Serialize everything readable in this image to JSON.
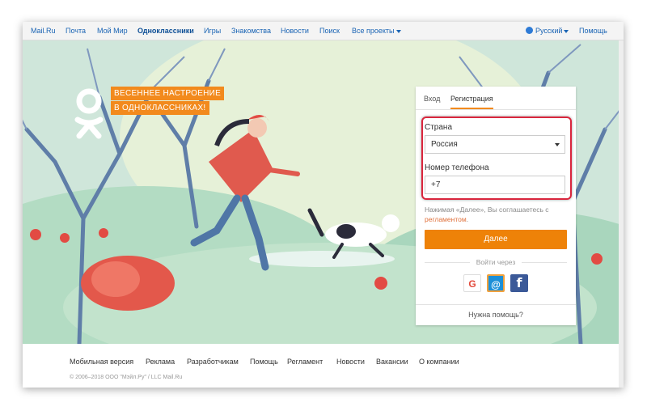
{
  "topbar": {
    "links": [
      "Mail.Ru",
      "Почта",
      "Мой Мир",
      "Одноклассники",
      "Игры",
      "Знакомства",
      "Новости",
      "Поиск",
      "Все проекты"
    ],
    "language": "Русский",
    "help": "Помощь"
  },
  "hero": {
    "promo_line1": "ВЕСЕННЕЕ НАСТРОЕНИЕ",
    "promo_line2": "В ОДНОКЛАССНИКАХ!"
  },
  "login": {
    "tab_login": "Вход",
    "tab_register": "Регистрация",
    "country_label": "Страна",
    "country_value": "Россия",
    "phone_label": "Номер телефона",
    "phone_value": "+7",
    "terms_text": "Нажимая «Далее», Вы соглашаетесь с",
    "terms_link": "регламентом",
    "next_button": "Далее",
    "login_via": "Войти через",
    "social": {
      "google": "G",
      "mail": "@",
      "facebook": "f"
    },
    "help_link": "Нужна помощь?"
  },
  "footer": {
    "links": [
      "Мобильная версия",
      "Реклама",
      "Разработчикам",
      "Помощь",
      "Регламент",
      "Новости",
      "Вакансии",
      "О компании"
    ],
    "copyright": "© 2006–2018 ООО \"Мэйл.Ру\" / LLC Mail.Ru"
  },
  "colors": {
    "accent": "#ee8208",
    "link": "#1a64b4",
    "highlight": "#d9263d"
  }
}
